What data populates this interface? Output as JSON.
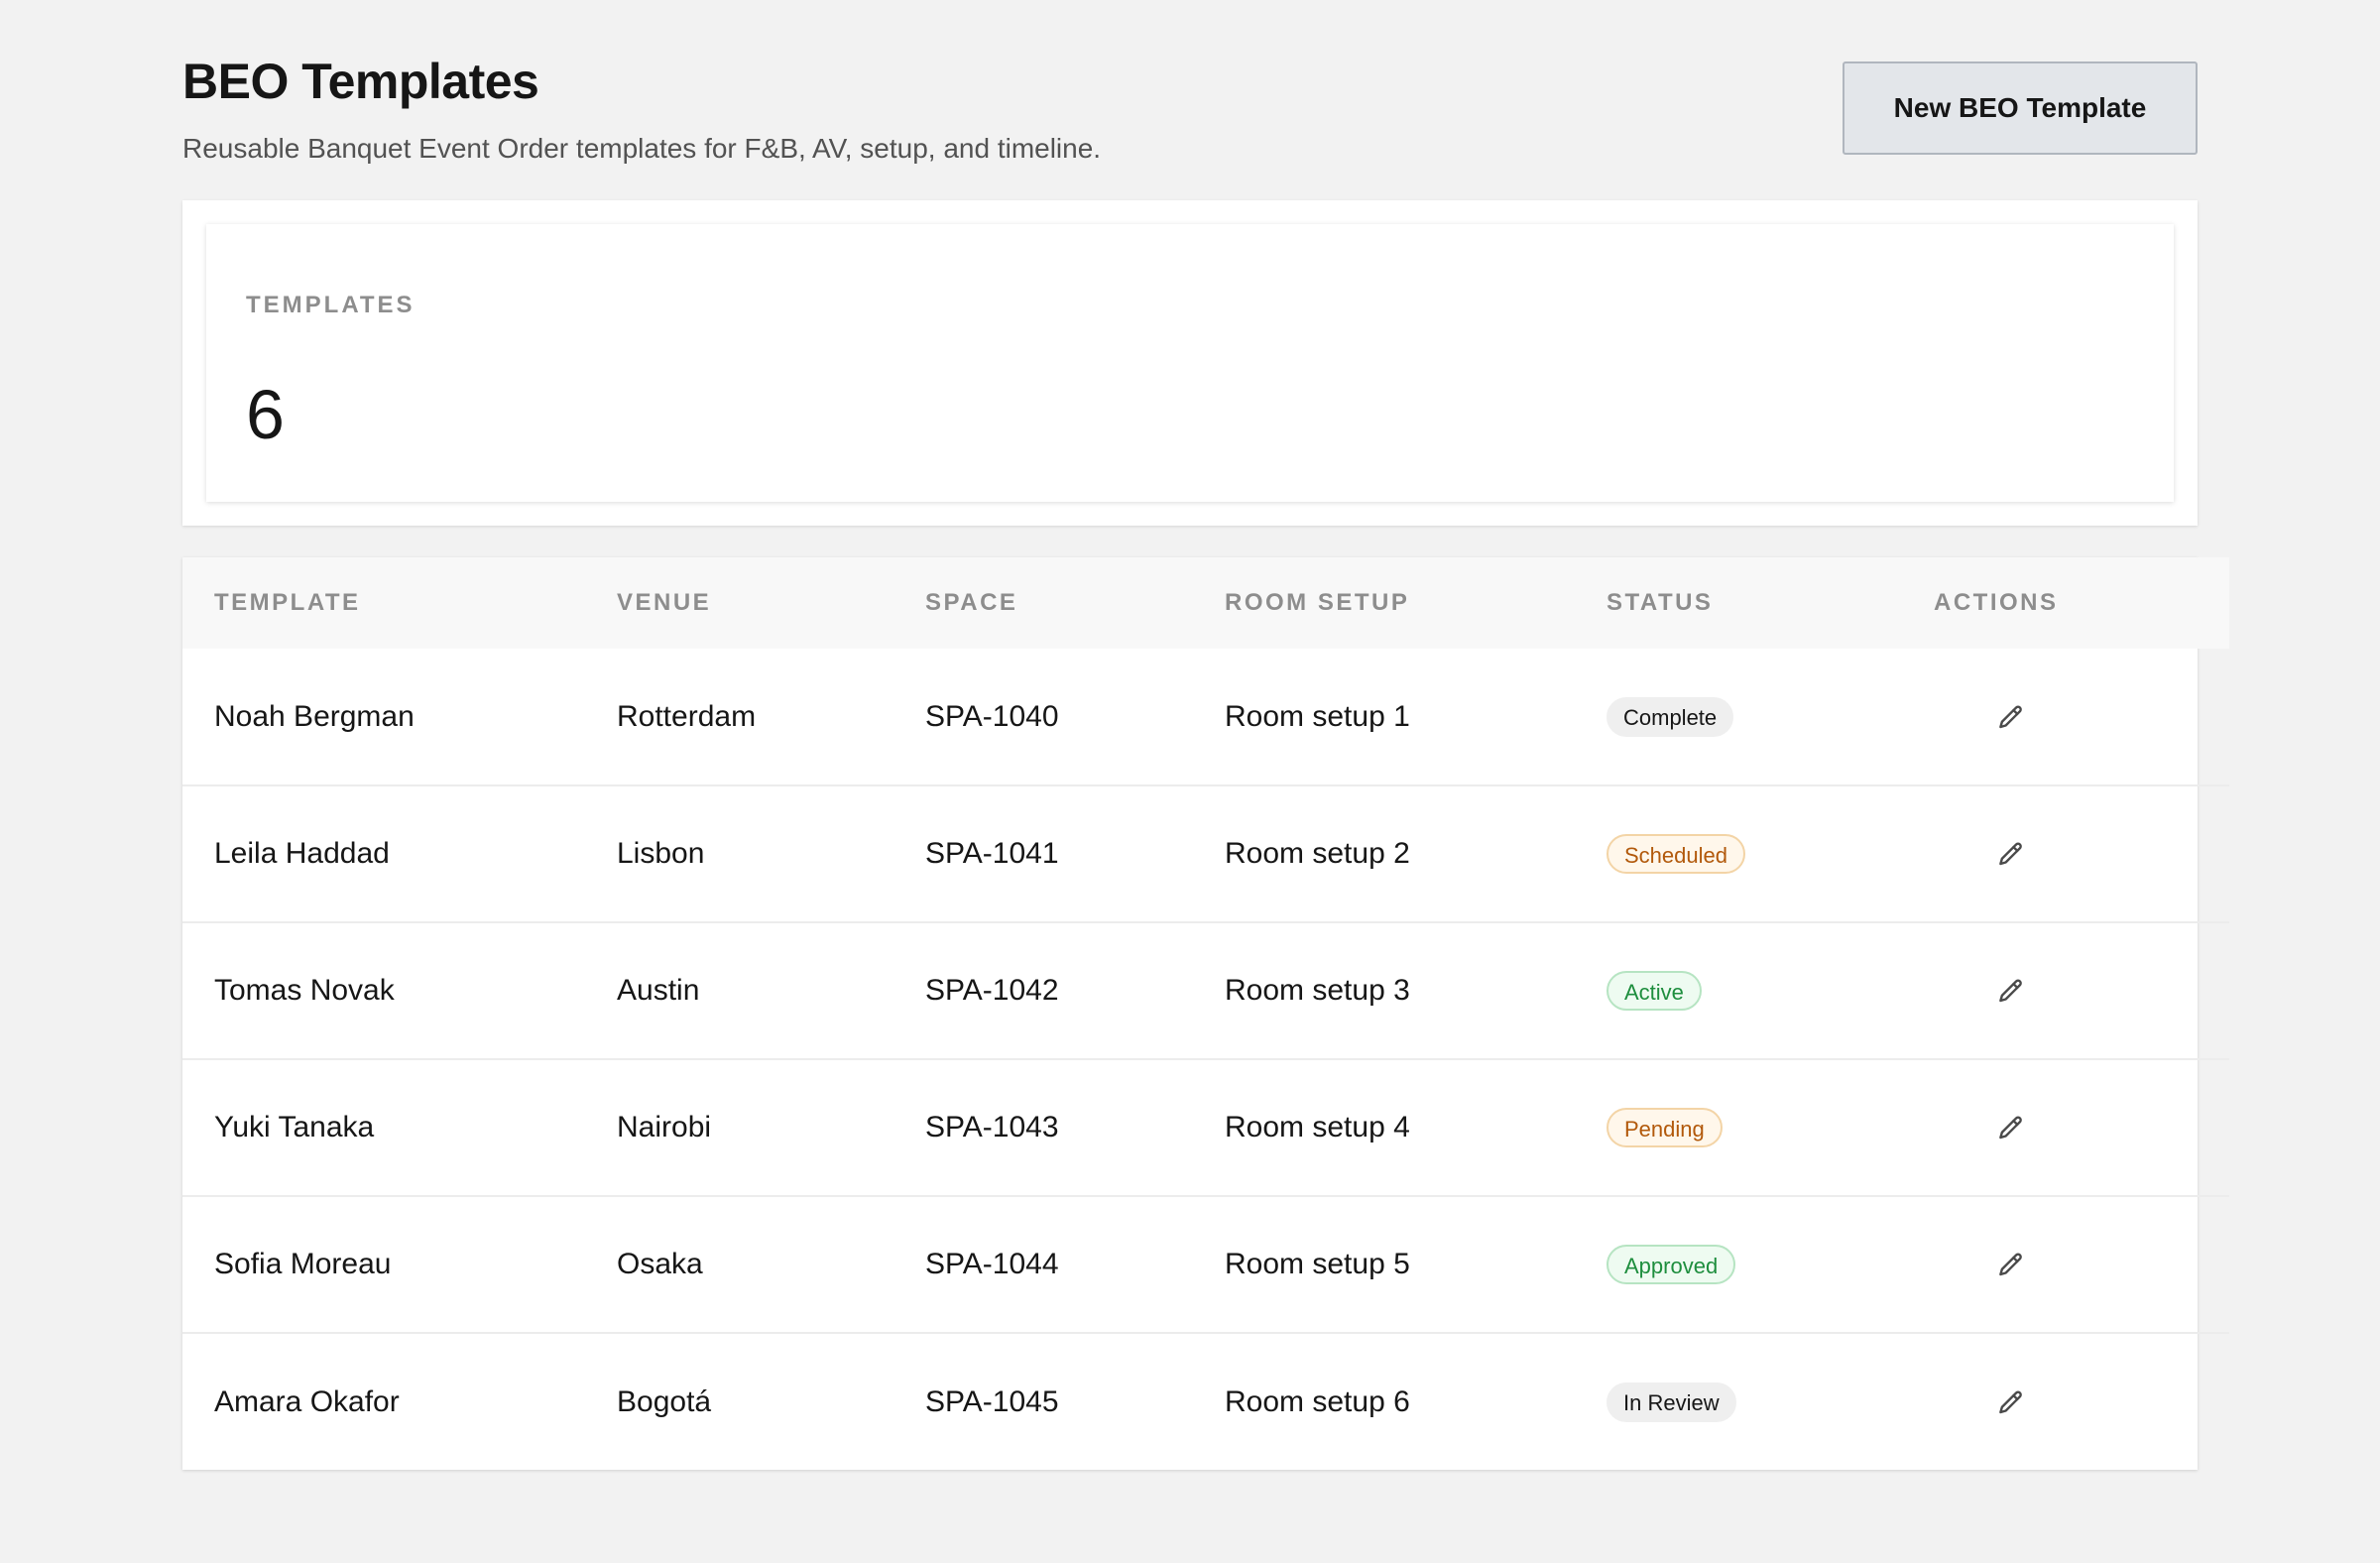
{
  "header": {
    "title": "BEO Templates",
    "subtitle": "Reusable Banquet Event Order templates for F&B, AV, setup, and timeline.",
    "new_button_label": "New BEO Template"
  },
  "stats": {
    "label": "TEMPLATES",
    "value": "6"
  },
  "table": {
    "columns": {
      "template": "TEMPLATE",
      "venue": "VENUE",
      "space": "SPACE",
      "room_setup": "ROOM SETUP",
      "status": "STATUS",
      "actions": "ACTIONS"
    },
    "rows": [
      {
        "template": "Noah Bergman",
        "venue": "Rotterdam",
        "space": "SPA-1040",
        "room_setup": "Room setup 1",
        "status": "Complete",
        "status_tone": "neutral",
        "action_icon": "pencil-icon"
      },
      {
        "template": "Leila Haddad",
        "venue": "Lisbon",
        "space": "SPA-1041",
        "room_setup": "Room setup 2",
        "status": "Scheduled",
        "status_tone": "warning",
        "action_icon": "pencil-icon"
      },
      {
        "template": "Tomas Novak",
        "venue": "Austin",
        "space": "SPA-1042",
        "room_setup": "Room setup 3",
        "status": "Active",
        "status_tone": "success",
        "action_icon": "pencil-icon"
      },
      {
        "template": "Yuki Tanaka",
        "venue": "Nairobi",
        "space": "SPA-1043",
        "room_setup": "Room setup 4",
        "status": "Pending",
        "status_tone": "warning",
        "action_icon": "pencil-icon"
      },
      {
        "template": "Sofia Moreau",
        "venue": "Osaka",
        "space": "SPA-1044",
        "room_setup": "Room setup 5",
        "status": "Approved",
        "status_tone": "success",
        "action_icon": "pencil-icon"
      },
      {
        "template": "Amara Okafor",
        "venue": "Bogotá",
        "space": "SPA-1045",
        "room_setup": "Room setup 6",
        "status": "In Review",
        "status_tone": "neutral",
        "action_icon": "pencil-icon"
      }
    ]
  },
  "colors": {
    "background": "#f2f2f2",
    "surface": "#ffffff",
    "text": "#161616",
    "muted": "#8d8d8d",
    "warning": "#b2590b",
    "success": "#1e8e3e"
  }
}
